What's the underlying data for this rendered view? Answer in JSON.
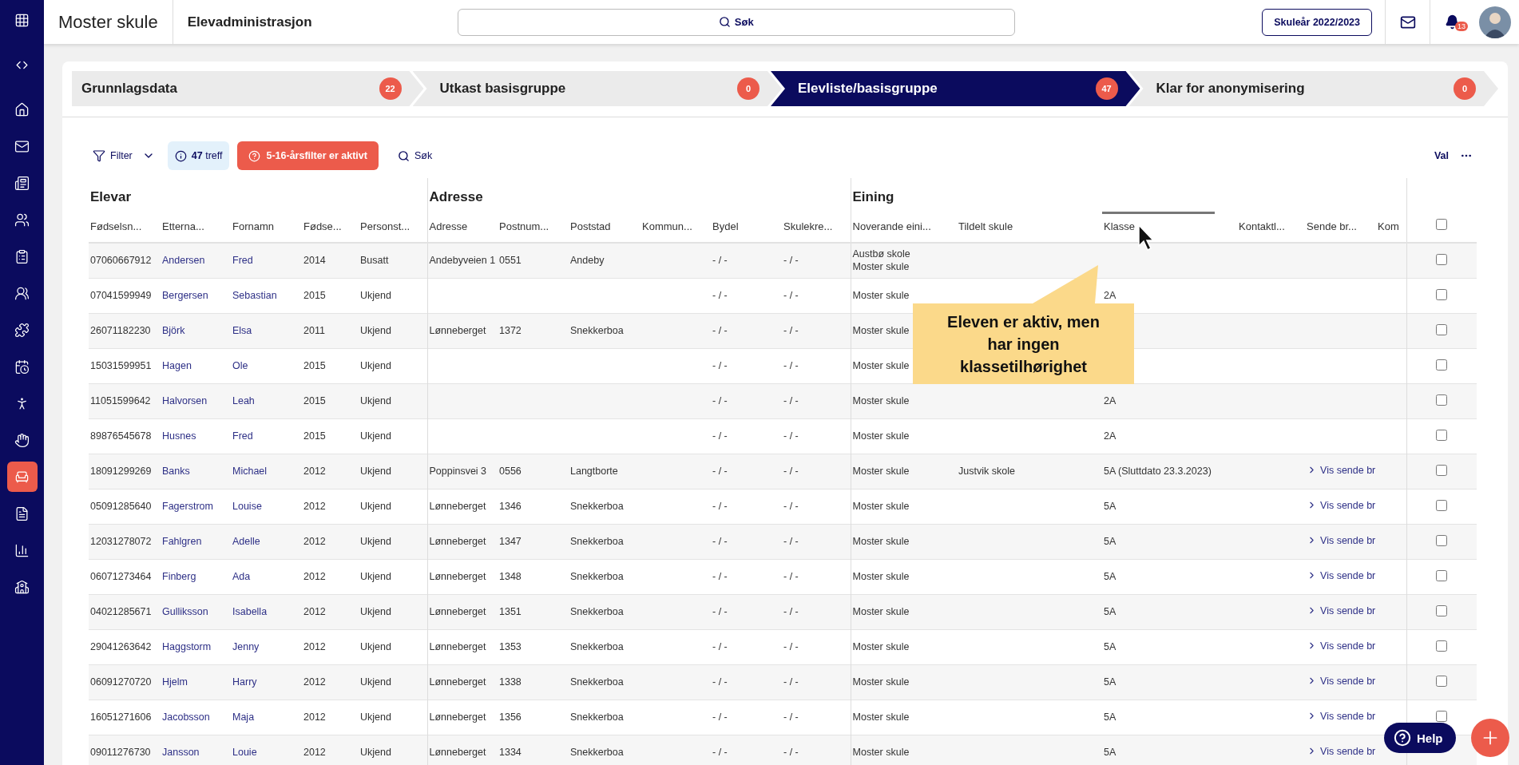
{
  "app": {
    "title": "Moster skule",
    "section": "Elevadministrasjon"
  },
  "search": {
    "placeholder": "Søk"
  },
  "school_year_button": "Skuleår 2022/2023",
  "notifications": {
    "count": "13"
  },
  "sidebar": {
    "items": [
      {
        "kind": "menu",
        "selected": false
      },
      {
        "kind": "toggle",
        "selected": false
      },
      {
        "kind": "home",
        "selected": false
      },
      {
        "kind": "mail",
        "selected": false
      },
      {
        "kind": "news",
        "selected": false
      },
      {
        "kind": "people",
        "selected": false
      },
      {
        "kind": "clipboard",
        "selected": false
      },
      {
        "kind": "group",
        "selected": false
      },
      {
        "kind": "puzzle",
        "selected": false
      },
      {
        "kind": "calendar",
        "selected": false
      },
      {
        "kind": "person",
        "selected": false
      },
      {
        "kind": "hand",
        "selected": false
      },
      {
        "kind": "desk",
        "selected": true
      },
      {
        "kind": "document",
        "selected": false
      },
      {
        "kind": "chart",
        "selected": false
      },
      {
        "kind": "school",
        "selected": false
      }
    ]
  },
  "steps": [
    {
      "label": "Grunnlagsdata",
      "count": "22",
      "selected": false
    },
    {
      "label": "Utkast basisgruppe",
      "count": "0",
      "selected": false
    },
    {
      "label": "Elevliste/basisgruppe",
      "count": "47",
      "selected": true
    },
    {
      "label": "Klar for anonymisering",
      "count": "0",
      "selected": false
    }
  ],
  "toolbar": {
    "filter": "Filter",
    "hits": "**47** treff",
    "alert": "5-16-årsfilter er aktivt",
    "search": "Søk",
    "view": "Val"
  },
  "table": {
    "groups": [
      {
        "label": "Elevar",
        "columns": [
          {
            "label": "Fødselsn...",
            "kind": "text",
            "active": false
          },
          {
            "label": "Etterna...",
            "kind": "link",
            "active": false
          },
          {
            "label": "Fornamn",
            "kind": "link",
            "active": false
          },
          {
            "label": "Fødse...",
            "kind": "text",
            "active": false
          },
          {
            "label": "Personst...",
            "kind": "text",
            "active": false
          }
        ]
      },
      {
        "label": "Adresse",
        "columns": [
          {
            "label": "Adresse",
            "kind": "text",
            "active": false
          },
          {
            "label": "Postnum...",
            "kind": "text",
            "active": false
          },
          {
            "label": "Poststad",
            "kind": "text",
            "active": false
          },
          {
            "label": "Kommun...",
            "kind": "text",
            "active": false
          },
          {
            "label": "Bydel",
            "kind": "text",
            "active": false
          },
          {
            "label": "Skulekre...",
            "kind": "text",
            "active": false
          }
        ]
      },
      {
        "label": "Eining",
        "columns": [
          {
            "label": "Noverande eini...",
            "kind": "text",
            "active": false
          },
          {
            "label": "Tildelt skule",
            "kind": "text",
            "active": false
          },
          {
            "label": "Klasse",
            "kind": "text",
            "active": true
          },
          {
            "label": "Kontaktl...",
            "kind": "text",
            "active": false
          },
          {
            "label": "Sende br...",
            "kind": "action",
            "active": false
          },
          {
            "label": "Kom",
            "kind": "text",
            "active": false
          }
        ]
      }
    ],
    "select_all": {
      "checked": false
    },
    "rows": [
      {
        "cells": [
          "07060667912",
          "Andersen",
          "Fred",
          "2014",
          "Busatt",
          "Andebyveien 1",
          "0551",
          "Andeby",
          null,
          "- / -",
          "- / -",
          "Austbø skole\nMoster skule",
          null,
          null,
          null,
          null,
          null
        ],
        "checked": false
      },
      {
        "cells": [
          "07041599949",
          "Bergersen",
          "Sebastian",
          "2015",
          "Ukjend",
          null,
          null,
          null,
          null,
          "- / -",
          "- / -",
          "Moster skule",
          null,
          "2A",
          null,
          null,
          null
        ],
        "checked": false
      },
      {
        "cells": [
          "26071182230",
          "Björk",
          "Elsa",
          "2011",
          "Ukjend",
          "Lønneberget",
          "1372",
          "Snekkerboa",
          null,
          "- / -",
          "- / -",
          "Moster skule",
          null,
          null,
          null,
          null,
          null
        ],
        "checked": false
      },
      {
        "cells": [
          "15031599951",
          "Hagen",
          "Ole",
          "2015",
          "Ukjend",
          null,
          null,
          null,
          null,
          "- / -",
          "- / -",
          "Moster skule",
          null,
          null,
          null,
          null,
          null
        ],
        "checked": false
      },
      {
        "cells": [
          "11051599642",
          "Halvorsen",
          "Leah",
          "2015",
          "Ukjend",
          null,
          null,
          null,
          null,
          "- / -",
          "- / -",
          "Moster skule",
          null,
          "2A",
          null,
          null,
          null
        ],
        "checked": false
      },
      {
        "cells": [
          "89876545678",
          "Husnes",
          "Fred",
          "2015",
          "Ukjend",
          null,
          null,
          null,
          null,
          "- / -",
          "- / -",
          "Moster skule",
          null,
          "2A",
          null,
          null,
          null
        ],
        "checked": false
      },
      {
        "cells": [
          "18091299269",
          "Banks",
          "Michael",
          "2012",
          "Ukjend",
          "Poppinsvei 3",
          "0556",
          "Langtborte",
          null,
          "- / -",
          "- / -",
          "Moster skule",
          "Justvik skole",
          "5A (Sluttdato 23.3.2023)",
          null,
          "Vis sende br",
          null
        ],
        "checked": false
      },
      {
        "cells": [
          "05091285640",
          "Fagerstrom",
          "Louise",
          "2012",
          "Ukjend",
          "Lønneberget",
          "1346",
          "Snekkerboa",
          null,
          "- / -",
          "- / -",
          "Moster skule",
          null,
          "5A",
          null,
          "Vis sende br",
          null
        ],
        "checked": false
      },
      {
        "cells": [
          "12031278072",
          "Fahlgren",
          "Adelle",
          "2012",
          "Ukjend",
          "Lønneberget",
          "1347",
          "Snekkerboa",
          null,
          "- / -",
          "- / -",
          "Moster skule",
          null,
          "5A",
          null,
          "Vis sende br",
          null
        ],
        "checked": false
      },
      {
        "cells": [
          "06071273464",
          "Finberg",
          "Ada",
          "2012",
          "Ukjend",
          "Lønneberget",
          "1348",
          "Snekkerboa",
          null,
          "- / -",
          "- / -",
          "Moster skule",
          null,
          "5A",
          null,
          "Vis sende br",
          null
        ],
        "checked": false
      },
      {
        "cells": [
          "04021285671",
          "Gulliksson",
          "Isabella",
          "2012",
          "Ukjend",
          "Lønneberget",
          "1351",
          "Snekkerboa",
          null,
          "- / -",
          "- / -",
          "Moster skule",
          null,
          "5A",
          null,
          "Vis sende br",
          null
        ],
        "checked": false
      },
      {
        "cells": [
          "29041263642",
          "Haggstorm",
          "Jenny",
          "2012",
          "Ukjend",
          "Lønneberget",
          "1353",
          "Snekkerboa",
          null,
          "- / -",
          "- / -",
          "Moster skule",
          null,
          "5A",
          null,
          "Vis sende br",
          null
        ],
        "checked": false
      },
      {
        "cells": [
          "06091270720",
          "Hjelm",
          "Harry",
          "2012",
          "Ukjend",
          "Lønneberget",
          "1338",
          "Snekkerboa",
          null,
          "- / -",
          "- / -",
          "Moster skule",
          null,
          "5A",
          null,
          "Vis sende br",
          null
        ],
        "checked": false
      },
      {
        "cells": [
          "16051271606",
          "Jacobsson",
          "Maja",
          "2012",
          "Ukjend",
          "Lønneberget",
          "1356",
          "Snekkerboa",
          null,
          "- / -",
          "- / -",
          "Moster skule",
          null,
          "5A",
          null,
          "Vis sende br",
          null
        ],
        "checked": false
      },
      {
        "cells": [
          "09011276730",
          "Jansson",
          "Louie",
          "2012",
          "Ukjend",
          "Lønneberget",
          "1334",
          "Snekkerboa",
          null,
          "- / -",
          "- / -",
          "Moster skule",
          null,
          "5A",
          null,
          "Vis sende br",
          null
        ]
      }
    ]
  },
  "callout": {
    "text": "Eleven er aktiv, men har ingen klassetilhørighet"
  },
  "help_button": "Help"
}
